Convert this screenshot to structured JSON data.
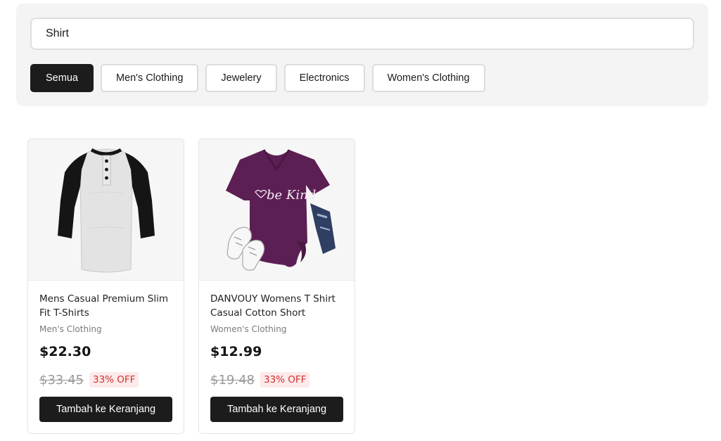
{
  "search": {
    "value": "Shirt",
    "placeholder": ""
  },
  "filters": [
    {
      "label": "Semua",
      "active": true
    },
    {
      "label": "Men's Clothing",
      "active": false
    },
    {
      "label": "Jewelery",
      "active": false
    },
    {
      "label": "Electronics",
      "active": false
    },
    {
      "label": "Women's Clothing",
      "active": false
    }
  ],
  "products": [
    {
      "title": "Mens Casual Premium Slim Fit T-Shirts",
      "category": "Men's Clothing",
      "price": "$22.30",
      "original_price": "$33.45",
      "discount": "33% OFF",
      "button_label": "Tambah ke Keranjang",
      "image_icon": "raglan-henley-shirt-icon"
    },
    {
      "title": "DANVOUY Womens T Shirt Casual Cotton Short",
      "category": "Women's Clothing",
      "price": "$12.99",
      "original_price": "$19.48",
      "discount": "33% OFF",
      "button_label": "Tambah ke Keranjang",
      "image_icon": "purple-vneck-tshirt-icon",
      "image_text": "be Kind"
    }
  ],
  "colors": {
    "accent_dark": "#1c1c1c",
    "discount_red": "#d32f2f",
    "discount_bg": "#fdeaea",
    "panel_bg": "#f4f4f4"
  }
}
